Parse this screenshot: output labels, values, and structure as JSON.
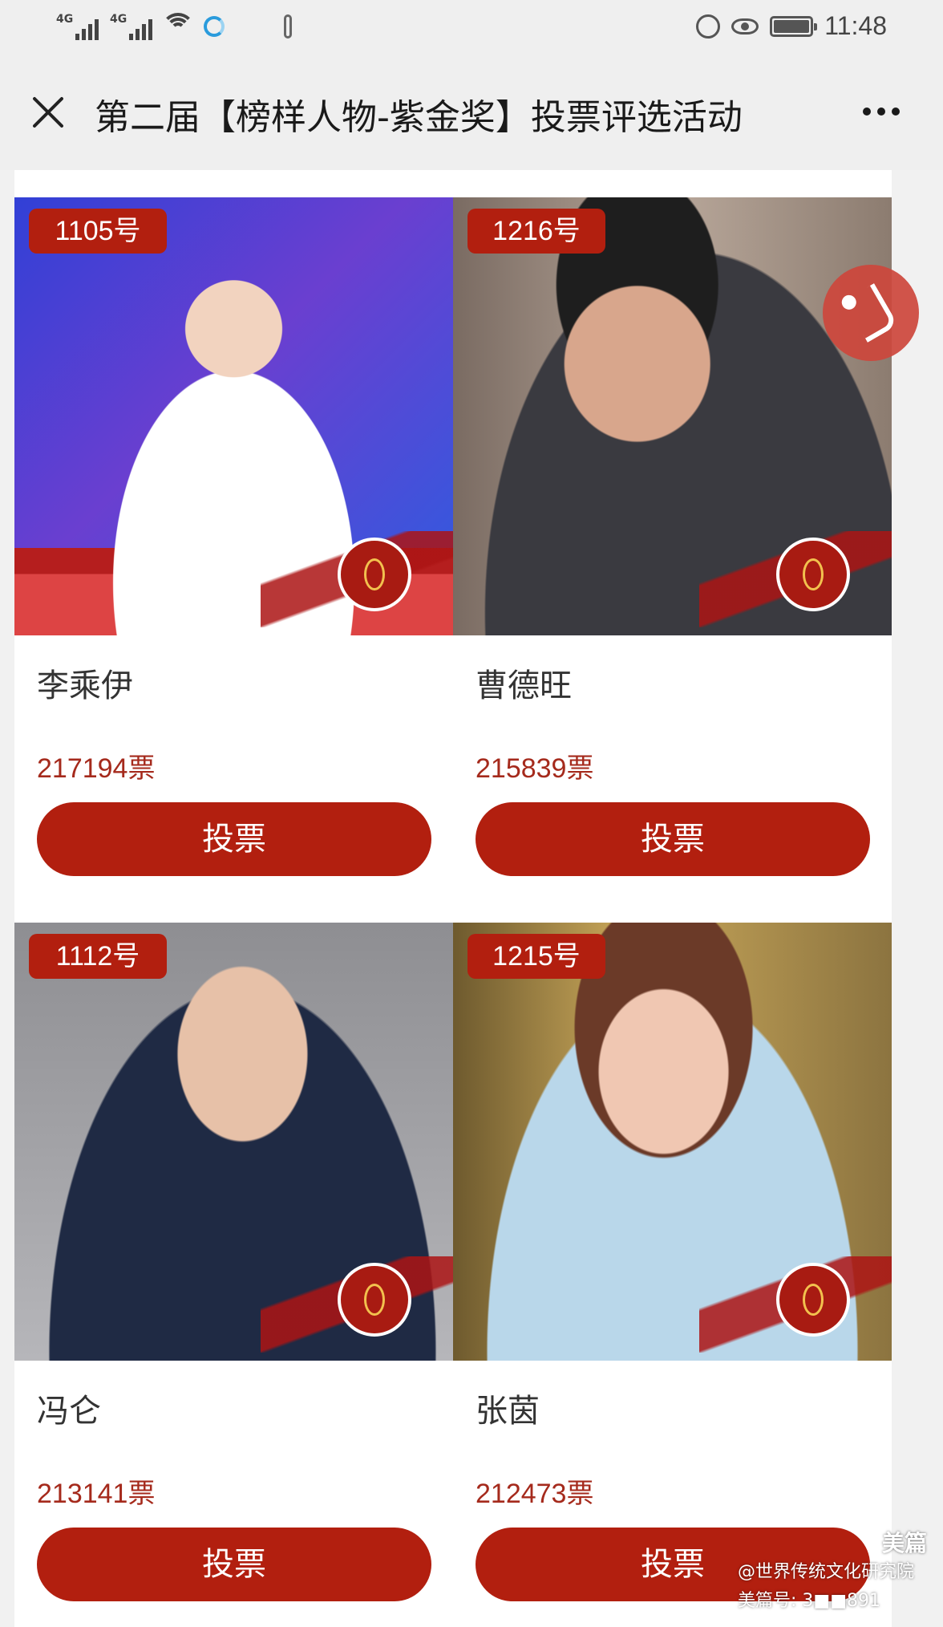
{
  "status_bar": {
    "signal_1": "4G",
    "signal_2": "4G",
    "time": "11:48"
  },
  "header": {
    "title": "第二届【榜样人物-紫金奖】投票评选活动"
  },
  "candidates": [
    {
      "number": "1105号",
      "name": "李乘伊",
      "votes": "217194票",
      "vote_label": "投票"
    },
    {
      "number": "1216号",
      "name": "曹德旺",
      "votes": "215839票",
      "vote_label": "投票"
    },
    {
      "number": "1112号",
      "name": "冯仑",
      "votes": "213141票",
      "vote_label": "投票"
    },
    {
      "number": "1215号",
      "name": "张茵",
      "votes": "212473票",
      "vote_label": "投票"
    }
  ],
  "watermark": {
    "brand": "美篇",
    "account": "@世界传统文化研究院",
    "id_line": "美篇号: 3■■891"
  },
  "colors": {
    "accent": "#b21f0f",
    "vote_count": "#a52a1c"
  }
}
